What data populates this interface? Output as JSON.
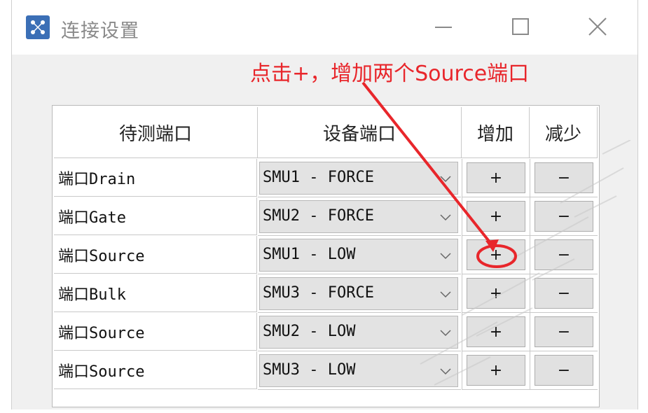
{
  "window": {
    "title": "连接设置",
    "controls": [
      "minimize",
      "maximize",
      "close"
    ]
  },
  "annotation": {
    "text": "点击+，增加两个Source端口",
    "color": "#e8262b"
  },
  "table": {
    "headers": [
      "待测端口",
      "设备端口",
      "增加",
      "减少"
    ],
    "rows": [
      {
        "port": "端口Drain",
        "device": "SMU1 - FORCE",
        "add": "+",
        "remove": "−"
      },
      {
        "port": "端口Gate",
        "device": "SMU2 - FORCE",
        "add": "+",
        "remove": "−"
      },
      {
        "port": "端口Source",
        "device": "SMU1 - LOW",
        "add": "+",
        "remove": "−"
      },
      {
        "port": "端口Bulk",
        "device": "SMU3 - FORCE",
        "add": "+",
        "remove": "−"
      },
      {
        "port": "端口Source",
        "device": "SMU2 - LOW",
        "add": "+",
        "remove": "−"
      },
      {
        "port": "端口Source",
        "device": "SMU3 - LOW",
        "add": "+",
        "remove": "−"
      }
    ]
  },
  "icons": {
    "app": "network-app-icon",
    "combo_arrow": "chevron-down-icon"
  }
}
